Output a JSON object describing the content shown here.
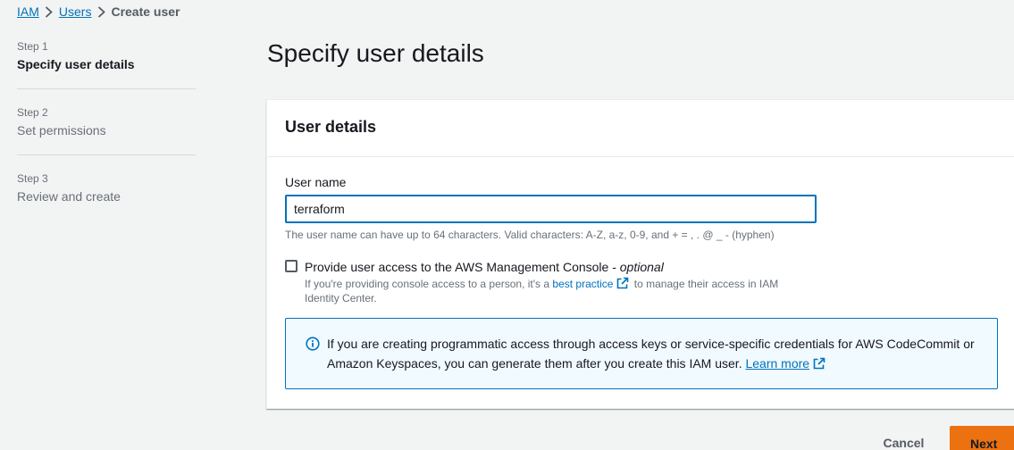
{
  "breadcrumb": {
    "items": [
      "IAM",
      "Users"
    ],
    "current": "Create user"
  },
  "steps": [
    {
      "num": "Step 1",
      "label": "Specify user details",
      "active": true
    },
    {
      "num": "Step 2",
      "label": "Set permissions",
      "active": false
    },
    {
      "num": "Step 3",
      "label": "Review and create",
      "active": false
    }
  ],
  "page_title": "Specify user details",
  "panel": {
    "title": "User details",
    "username": {
      "label": "User name",
      "value": "terraform",
      "hint": "The user name can have up to 64 characters. Valid characters: A-Z, a-z, 0-9, and + = , . @ _ - (hyphen)"
    },
    "console_access": {
      "checked": false,
      "label": "Provide user access to the AWS Management Console - ",
      "label_optional": "optional",
      "desc_before": "If you're providing console access to a person, it's a ",
      "desc_link": "best practice",
      "desc_after": " to manage their access in IAM Identity Center."
    },
    "info": {
      "text": "If you are creating programmatic access through access keys or service-specific credentials for AWS CodeCommit or Amazon Keyspaces, you can generate them after you create this IAM user. ",
      "link": "Learn more"
    }
  },
  "footer": {
    "cancel_label": "Cancel",
    "next_label": "Next"
  },
  "colors": {
    "link": "#0073bb",
    "primary_button": "#ec7211",
    "info_bg": "#f1faff"
  }
}
